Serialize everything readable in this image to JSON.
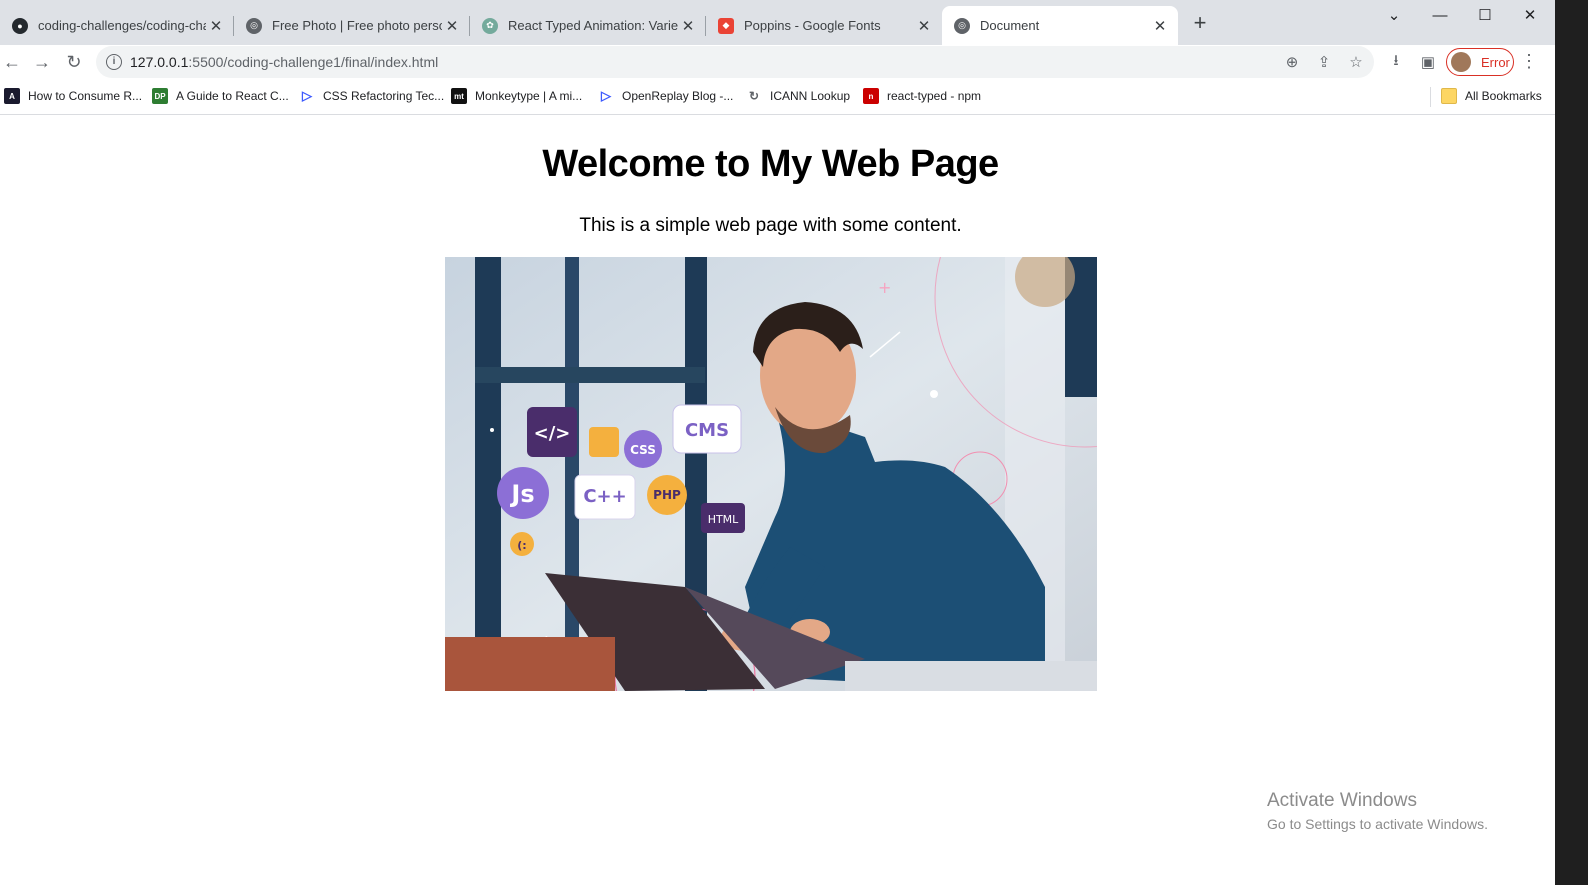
{
  "tabs": [
    {
      "title": "coding-challenges/coding-challe",
      "icon": "github-icon",
      "active": false
    },
    {
      "title": "Free Photo | Free photo person i",
      "icon": "globe-icon",
      "active": false
    },
    {
      "title": "React Typed Animation: Variety",
      "icon": "openai-icon",
      "active": false
    },
    {
      "title": "Poppins - Google Fonts",
      "icon": "google-fonts-icon",
      "active": false
    },
    {
      "title": "Document",
      "icon": "globe-icon",
      "active": true
    }
  ],
  "address": {
    "host": "127.0.0.1",
    "rest": ":5500/coding-challenge1/final/index.html"
  },
  "profile": {
    "label": "Error"
  },
  "bookmarks": [
    {
      "label": "How to Consume R...",
      "icon": "a-icon",
      "color": "#1a1a2e"
    },
    {
      "label": "A Guide to React C...",
      "icon": "dp-icon",
      "color": "#2e7d32"
    },
    {
      "label": "CSS Refactoring Tec...",
      "icon": "triangle-icon",
      "color": "#3d5afe"
    },
    {
      "label": "Monkeytype | A mi...",
      "icon": "mt-icon",
      "color": "#111111"
    },
    {
      "label": "OpenReplay Blog -...",
      "icon": "triangle-icon",
      "color": "#3d5afe"
    },
    {
      "label": "ICANN Lookup",
      "icon": "icann-icon",
      "color": "#5f6368"
    },
    {
      "label": "react-typed - npm",
      "icon": "npm-icon",
      "color": "#cb0000"
    }
  ],
  "all_bookmarks": "All Bookmarks",
  "page": {
    "title": "Welcome to My Web Page",
    "subtitle": "This is a simple web page with some content."
  },
  "hero": {
    "bubbles": {
      "code": "</>",
      "cms": "CMS",
      "css": "CSS",
      "js": "Js",
      "cpp": "C++",
      "php": "PHP",
      "html": "HTML",
      "smile": "(:"
    }
  },
  "watermark": {
    "line1": "Activate Windows",
    "line2": "Go to Settings to activate Windows."
  }
}
